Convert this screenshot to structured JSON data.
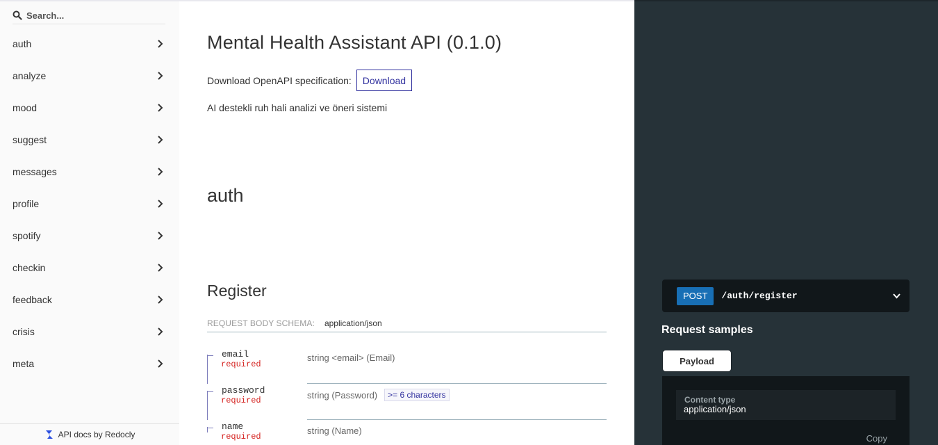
{
  "sidebar": {
    "search_placeholder": "Search...",
    "items": [
      {
        "label": "auth"
      },
      {
        "label": "analyze"
      },
      {
        "label": "mood"
      },
      {
        "label": "suggest"
      },
      {
        "label": "messages"
      },
      {
        "label": "profile"
      },
      {
        "label": "spotify"
      },
      {
        "label": "checkin"
      },
      {
        "label": "feedback"
      },
      {
        "label": "crisis"
      },
      {
        "label": "meta"
      }
    ],
    "footer": "API docs by Redocly"
  },
  "content": {
    "api_title": "Mental Health Assistant API (0.1.0)",
    "download_label": "Download OpenAPI specification:",
    "download_button": "Download",
    "description": "AI destekli ruh hali analizi ve öneri sistemi",
    "tag_title": "auth",
    "operation_title": "Register",
    "request_body_label": "REQUEST BODY SCHEMA:",
    "request_body_type": "application/json",
    "fields": [
      {
        "name": "email",
        "required": "required",
        "type": "string <email> (Email)",
        "constraint": ""
      },
      {
        "name": "password",
        "required": "required",
        "type": "string (Password)",
        "constraint": ">= 6 characters"
      },
      {
        "name": "name",
        "required": "required",
        "type": "string (Name)",
        "constraint": ""
      }
    ]
  },
  "right_panel": {
    "method": "POST",
    "path": "/auth/register",
    "samples_title": "Request samples",
    "payload_tab": "Payload",
    "content_type_label": "Content type",
    "content_type_value": "application/json",
    "copy_label": "Copy"
  },
  "colors": {
    "accent": "#32329f",
    "required": "#d41f1c",
    "post_method": "#186fb5",
    "right_panel_bg": "#263238",
    "sample_bg": "#11171a"
  }
}
